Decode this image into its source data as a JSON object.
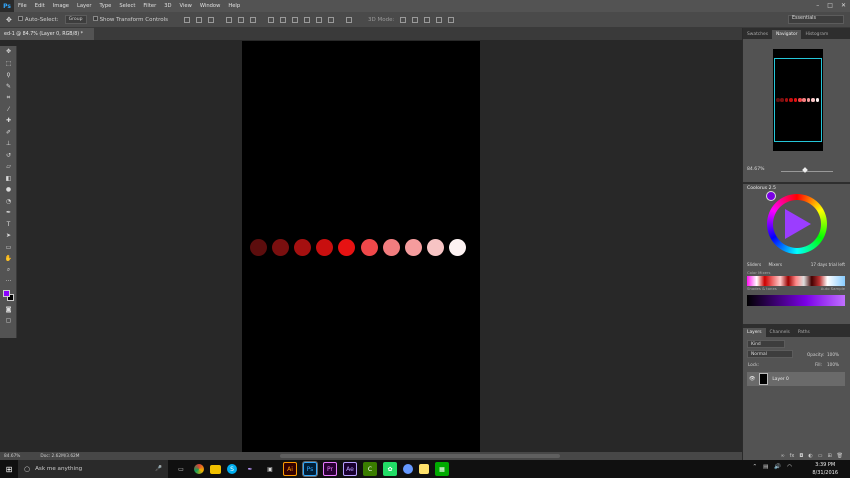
{
  "app": {
    "logo": "Ps"
  },
  "menu": [
    "File",
    "Edit",
    "Image",
    "Layer",
    "Type",
    "Select",
    "Filter",
    "3D",
    "View",
    "Window",
    "Help"
  ],
  "options": {
    "auto_select": "Auto-Select:",
    "group": "Group",
    "transform": "Show Transform Controls",
    "mode3d": "3D Mode:",
    "workspace": "Essentials"
  },
  "document": {
    "tab": "ed-1 @ 84.7% (Layer 0, RGB/8) *"
  },
  "status": {
    "zoom": "84.67%",
    "doc": "Doc: 2.62M/3.62M"
  },
  "navigator": {
    "tabs": [
      "Swatches",
      "Navigator",
      "Histogram"
    ],
    "active": 1,
    "zoom": "84.67%"
  },
  "coolorus": {
    "title": "Coolorus 2.5",
    "sliders": "Sliders",
    "mixers": "Mixers",
    "trial": "17 days trial left",
    "color_sets": "Color Mixers",
    "shades": "Shades & tones",
    "auto_sample": "Auto Sample"
  },
  "layers": {
    "tabs": [
      "Layers",
      "Channels",
      "Paths"
    ],
    "kind": "Kind",
    "blend": "Normal",
    "opacity_label": "Opacity:",
    "opacity": "100%",
    "lock": "Lock:",
    "fill_label": "Fill:",
    "fill": "100%",
    "layer_name": "Layer 0"
  },
  "taskbar": {
    "search_placeholder": "Ask me anything",
    "time": "3:39 PM",
    "date": "8/31/2016"
  },
  "dots": [
    {
      "color": "#5c0d0d"
    },
    {
      "color": "#7a0f0f"
    },
    {
      "color": "#a51010"
    },
    {
      "color": "#c80f0f"
    },
    {
      "color": "#e61212"
    },
    {
      "color": "#f0484a"
    },
    {
      "color": "#f27d7f"
    },
    {
      "color": "#f59c9d"
    },
    {
      "color": "#f7c4c4"
    },
    {
      "color": "#fdf2f2"
    }
  ],
  "colors": {
    "foreground": "#8a00ff",
    "background": "#000000"
  }
}
